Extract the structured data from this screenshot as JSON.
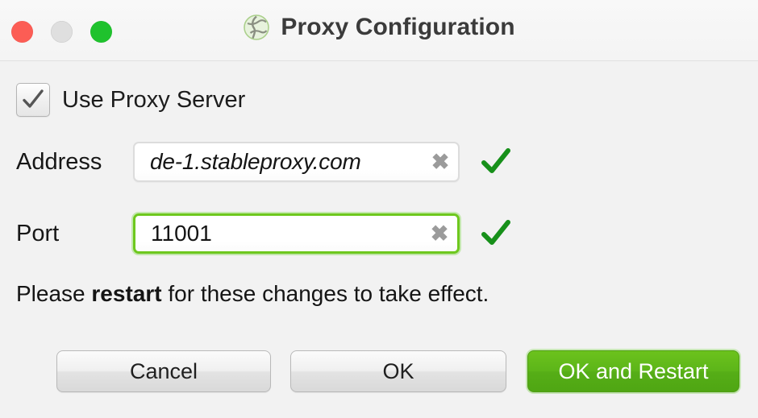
{
  "window": {
    "title": "Proxy Configuration",
    "title_icon": "globe-network-icon",
    "traffic_lights": {
      "close": "close-window-button",
      "minimize": "minimize-window-button",
      "zoom": "zoom-window-button"
    }
  },
  "form": {
    "use_proxy": {
      "label": "Use Proxy Server",
      "checked": true,
      "check_glyph": "checkmark-icon"
    },
    "address": {
      "label": "Address",
      "value": "de-1.stableproxy.com",
      "placeholder": "de-1.stableproxy.com",
      "clear_glyph": "✖",
      "valid": true,
      "focused": false
    },
    "port": {
      "label": "Port",
      "value": "11001",
      "placeholder": "11001",
      "clear_glyph": "✖",
      "valid": true,
      "focused": true
    },
    "note": {
      "prefix": "Please ",
      "emphasis": "restart",
      "suffix": " for these changes to take effect."
    }
  },
  "buttons": {
    "cancel": "Cancel",
    "ok": "OK",
    "ok_and_restart": "OK and Restart"
  },
  "colors": {
    "accent_green": "#5cb519",
    "focus_ring_green": "#6ec81e",
    "valid_check_green": "#17901a",
    "traffic_close": "#fc5d55",
    "traffic_minimize": "#dfdfdf",
    "traffic_zoom": "#1fc22d",
    "window_background": "#f2f2f2",
    "titlebar_background": "#f6f6f6",
    "text_primary": "#171717",
    "title_text": "#3b3b3b"
  }
}
